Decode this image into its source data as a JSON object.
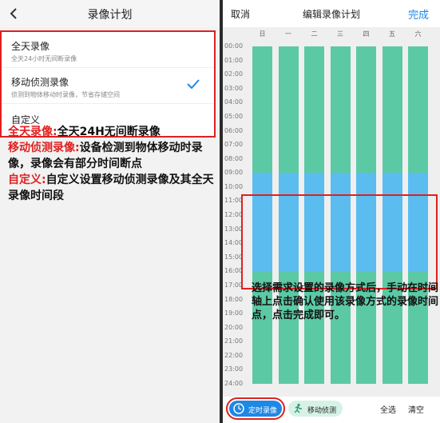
{
  "left": {
    "title": "录像计划",
    "options": [
      {
        "title": "全天录像",
        "subtitle": "全天24小时无间断录像",
        "selected": false
      },
      {
        "title": "移动侦测录像",
        "subtitle": "侦测到物体移动时录像，节省存储空间",
        "selected": true
      },
      {
        "title": "自定义",
        "subtitle": "",
        "selected": false
      }
    ],
    "annotation": {
      "l1_label": "全天录像:",
      "l1_text": "全天24H无间断录像",
      "l2_label": "移动侦测录像:",
      "l2_text": "设备检测到物体移动时录像，录像会有部分时间断点",
      "l3_label": "自定义:",
      "l3_text": "自定义设置移动侦测录像及其全天录像时间段"
    }
  },
  "right": {
    "cancel": "取消",
    "title": "编辑录像计划",
    "done": "完成",
    "days": [
      "日",
      "一",
      "二",
      "三",
      "四",
      "五",
      "六"
    ],
    "times": [
      "00:00",
      "01:00",
      "02:00",
      "03:00",
      "04:00",
      "05:00",
      "06:00",
      "07:00",
      "08:00",
      "09:00",
      "10:00",
      "11:00",
      "12:00",
      "13:00",
      "14:00",
      "15:00",
      "16:00",
      "17:00",
      "18:00",
      "19:00",
      "20:00",
      "21:00",
      "22:00",
      "23:00",
      "24:00"
    ],
    "selected_hours": [
      9,
      15
    ],
    "annotation": "选择需求设置的录像方式后，手动在时间轴上点击确认使用该录像方式的录像时间点，点击完成即可。",
    "footer": {
      "timed": "定时录像",
      "motion": "移动侦测",
      "select_all": "全选",
      "clear": "清空"
    },
    "colors": {
      "recording": "#5cc9a5",
      "selected": "#5bbcf0",
      "accent": "#1e88e5",
      "highlight": "#e02020"
    }
  }
}
